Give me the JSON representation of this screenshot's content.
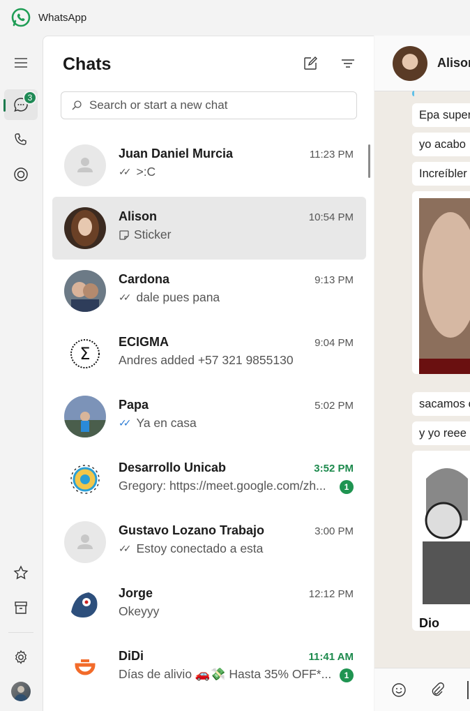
{
  "app": {
    "title": "WhatsApp",
    "accent": "#1f8a55"
  },
  "rail": {
    "chats_badge": "3"
  },
  "chats": {
    "title": "Chats",
    "search_placeholder": "Search or start a new chat",
    "items": [
      {
        "name": "Juan Daniel Murcia",
        "time": "11:23 PM",
        "preview": ">:C",
        "ticks": "read-grey",
        "avatar": "default"
      },
      {
        "name": "Alison",
        "time": "10:54 PM",
        "preview": "Sticker",
        "ticks": "sticker",
        "avatar": "photo",
        "selected": true
      },
      {
        "name": "Cardona",
        "time": "9:13 PM",
        "preview": "dale pues pana",
        "ticks": "read-grey",
        "avatar": "photo"
      },
      {
        "name": "ECIGMA",
        "time": "9:04 PM",
        "preview": "Andres added +57 321 9855130",
        "ticks": "none",
        "avatar": "sigma"
      },
      {
        "name": "Papa",
        "time": "5:02 PM",
        "preview": "Ya en casa",
        "ticks": "read-blue",
        "avatar": "photo"
      },
      {
        "name": "Desarrollo Unicab",
        "time": "3:52 PM",
        "preview": "Gregory: https://meet.google.com/zh...",
        "ticks": "none",
        "avatar": "logo",
        "unread": "1"
      },
      {
        "name": "Gustavo Lozano Trabajo",
        "time": "3:00 PM",
        "preview": "Estoy conectado a esta",
        "ticks": "read-grey",
        "avatar": "default"
      },
      {
        "name": "Jorge",
        "time": "12:12 PM",
        "preview": "Okeyyy",
        "ticks": "none",
        "avatar": "drawing"
      },
      {
        "name": "DiDi",
        "time": "11:41 AM",
        "preview": "Días de alivio 🚗💸  Hasta 35% OFF*...",
        "ticks": "none",
        "avatar": "didi",
        "unread": "1"
      }
    ]
  },
  "conversation": {
    "name": "Alison",
    "messages": [
      "Epa super",
      "yo acabo",
      "Increíbler",
      "sacamos c",
      "y yo reee"
    ],
    "sticker_text": "Dio"
  }
}
